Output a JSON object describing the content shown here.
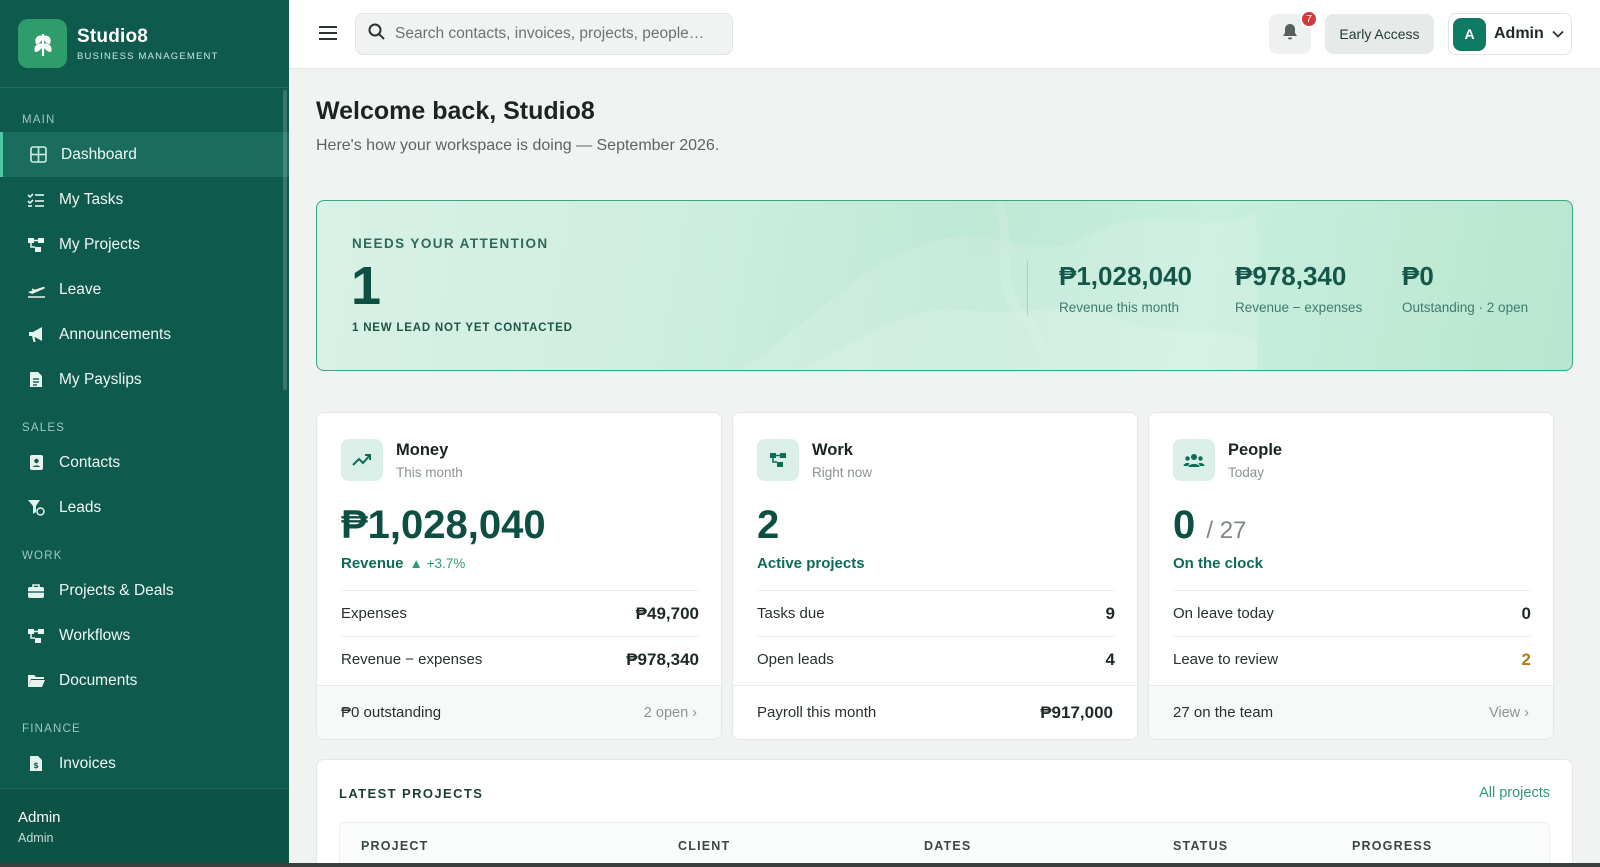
{
  "brand": {
    "name": "Studio8",
    "tagline": "BUSINESS MANAGEMENT"
  },
  "sidebar": {
    "sections": [
      {
        "title": "MAIN",
        "items": [
          {
            "label": "Dashboard",
            "icon": "grid-icon",
            "active": true
          },
          {
            "label": "My Tasks",
            "icon": "tasks-icon"
          },
          {
            "label": "My Projects",
            "icon": "projects-icon"
          },
          {
            "label": "Leave",
            "icon": "plane-icon"
          },
          {
            "label": "Announcements",
            "icon": "megaphone-icon"
          },
          {
            "label": "My Payslips",
            "icon": "payslip-icon"
          }
        ]
      },
      {
        "title": "SALES",
        "items": [
          {
            "label": "Contacts",
            "icon": "contact-card-icon"
          },
          {
            "label": "Leads",
            "icon": "funnel-icon"
          }
        ]
      },
      {
        "title": "WORK",
        "items": [
          {
            "label": "Projects & Deals",
            "icon": "briefcase-icon"
          },
          {
            "label": "Workflows",
            "icon": "workflow-icon"
          },
          {
            "label": "Documents",
            "icon": "folder-icon"
          }
        ]
      },
      {
        "title": "FINANCE",
        "items": [
          {
            "label": "Invoices",
            "icon": "invoice-icon"
          }
        ]
      }
    ],
    "user": {
      "name": "Admin",
      "role": "Admin"
    }
  },
  "topbar": {
    "search_placeholder": "Search contacts, invoices, projects, people…",
    "notifications_count": "7",
    "early_access_label": "Early Access",
    "user_initial": "A",
    "user_name": "Admin"
  },
  "main": {
    "welcome_title": "Welcome back, Studio8",
    "welcome_subtitle": "Here's how your workspace is doing — September 2026.",
    "attention": {
      "label": "NEEDS YOUR ATTENTION",
      "count": "1",
      "description": "1 NEW LEAD NOT YET CONTACTED",
      "stats": [
        {
          "value": "₱1,028,040",
          "label": "Revenue this month"
        },
        {
          "value": "₱978,340",
          "label": "Revenue − expenses"
        },
        {
          "value": "₱0",
          "label": "Outstanding · 2 open"
        }
      ]
    },
    "cards": {
      "money": {
        "title": "Money",
        "subtitle": "This month",
        "big": "₱1,028,040",
        "big_label": "Revenue",
        "delta": "▲ +3.7%",
        "rows": [
          {
            "label": "Expenses",
            "value": "₱49,700"
          },
          {
            "label": "Revenue − expenses",
            "value": "₱978,340"
          }
        ],
        "footer_left": "₱0 outstanding",
        "footer_right": "2 open ›"
      },
      "work": {
        "title": "Work",
        "subtitle": "Right now",
        "big": "2",
        "big_label": "Active projects",
        "rows": [
          {
            "label": "Tasks due",
            "value": "9"
          },
          {
            "label": "Open leads",
            "value": "4"
          }
        ],
        "footer_left": "Payroll this month",
        "footer_value": "₱917,000"
      },
      "people": {
        "title": "People",
        "subtitle": "Today",
        "big": "0",
        "big_of": "/ 27",
        "big_label": "On the clock",
        "rows": [
          {
            "label": "On leave today",
            "value": "0"
          },
          {
            "label": "Leave to review",
            "value": "2"
          }
        ],
        "footer_left": "27 on the team",
        "footer_right": "View ›"
      }
    },
    "projects": {
      "title": "LATEST PROJECTS",
      "link": "All projects",
      "columns": [
        "PROJECT",
        "CLIENT",
        "DATES",
        "STATUS",
        "PROGRESS"
      ]
    }
  }
}
